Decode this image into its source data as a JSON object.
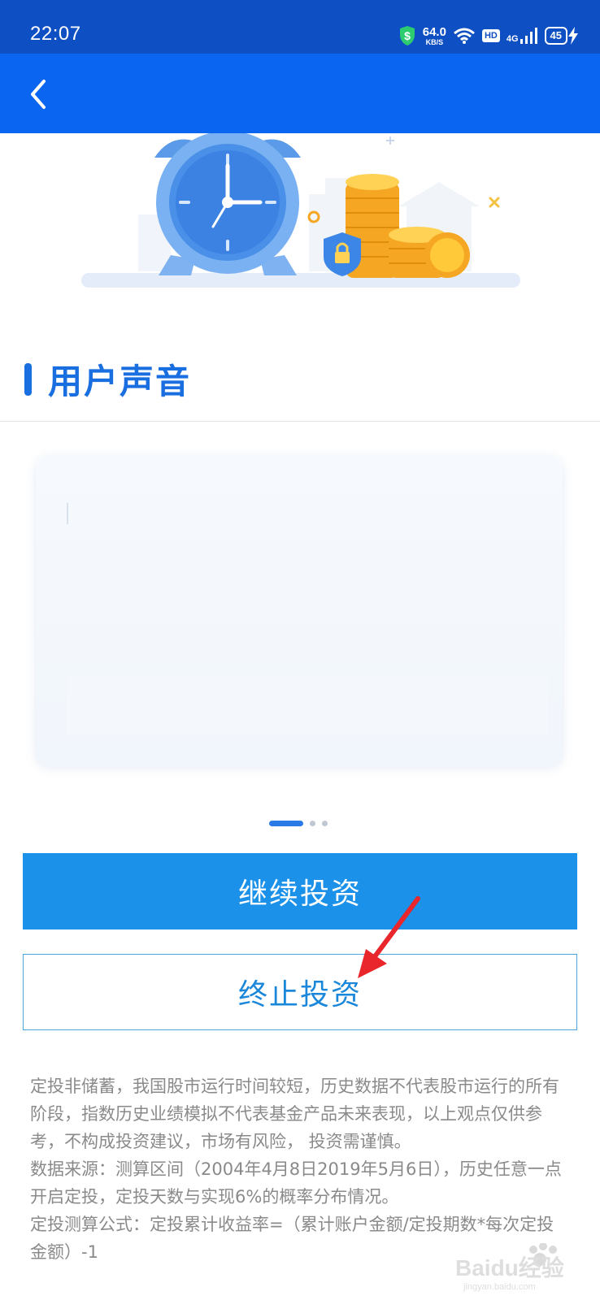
{
  "status_bar": {
    "time": "22:07",
    "net_speed_value": "64.0",
    "net_speed_unit": "KB/S",
    "hd_label": "HD",
    "network_label": "4G",
    "battery_level": "45"
  },
  "section": {
    "title": "用户声音"
  },
  "carousel": {
    "page_count": 3,
    "active_index": 0
  },
  "buttons": {
    "continue_label": "继续投资",
    "stop_label": "终止投资"
  },
  "disclaimer": {
    "line1": "定投非储蓄，我国股市运行时间较短，历史数据不代表股市运行的所有阶段，指数历史业绩模拟不代表基金产品未来表现，以上观点仅供参考，不构成投资建议，市场有风险， 投资需谨慎。",
    "line2": "数据来源：测算区间（2004年4月8日2019年5月6日），历史任意一点开启定投，定投天数与实现6%的概率分布情况。",
    "line3": "定投测算公式：定投累计收益率=（累计账户金额/定投期数*每次定投金额）-1"
  },
  "colors": {
    "status_bar": "#0f4fc4",
    "nav_bar": "#0a66f0",
    "accent": "#1a6fe0",
    "primary_button": "#1b91ea",
    "annotation_arrow": "#e8262b"
  },
  "watermark": {
    "text": "Baidu经验",
    "sub": "jingyan.baidu.com"
  }
}
